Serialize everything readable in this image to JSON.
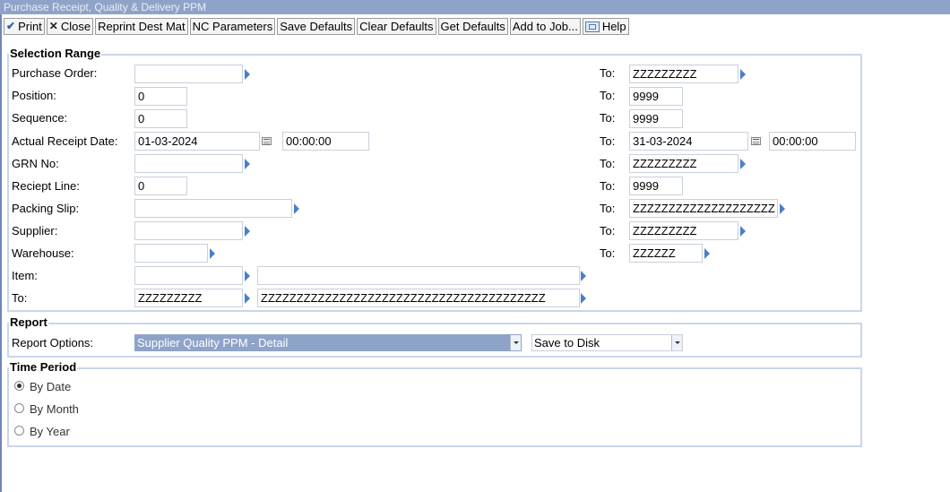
{
  "window": {
    "title": "Purchase Receipt, Quality & Delivery PPM"
  },
  "toolbar": {
    "print": "Print",
    "close": "Close",
    "reprint": "Reprint Dest Mat",
    "nc_parameters": "NC Parameters",
    "save_defaults": "Save Defaults",
    "clear_defaults": "Clear Defaults",
    "get_defaults": "Get Defaults",
    "add_to_job": "Add to Job...",
    "help": "Help"
  },
  "selection": {
    "title": "Selection Range",
    "to_label": "To:",
    "rows": [
      {
        "label": "Purchase Order:",
        "from": "",
        "to": "ZZZZZZZZZ"
      },
      {
        "label": "Position:",
        "from": "0",
        "to": "9999"
      },
      {
        "label": "Sequence:",
        "from": "0",
        "to": "9999"
      },
      {
        "label": "Actual Receipt Date:",
        "from": "01-03-2024",
        "from_time": "00:00:00",
        "to": "31-03-2024",
        "to_time": "00:00:00"
      },
      {
        "label": "GRN No:",
        "from": "",
        "to": "ZZZZZZZZZ"
      },
      {
        "label": "Reciept Line:",
        "from": "0",
        "to": "9999"
      },
      {
        "label": "Packing Slip:",
        "from": "",
        "to": "ZZZZZZZZZZZZZZZZZZZZ"
      },
      {
        "label": "Supplier:",
        "from": "",
        "to": "ZZZZZZZZZ"
      },
      {
        "label": "Warehouse:",
        "from": "",
        "to": "ZZZZZZ"
      }
    ],
    "item": {
      "label": "Item:",
      "code": "",
      "desc": ""
    },
    "item_to": {
      "label": "To:",
      "code": "ZZZZZZZZZ",
      "desc": "ZZZZZZZZZZZZZZZZZZZZZZZZZZZZZZZZZZZZZZZZ"
    }
  },
  "report": {
    "title": "Report",
    "options_label": "Report Options:",
    "options_value": "Supplier Quality PPM - Detail",
    "output_value": "Save to Disk"
  },
  "time_period": {
    "title": "Time Period",
    "options": [
      "By Date",
      "By Month",
      "By Year"
    ],
    "selected": "By Date"
  },
  "icons": {
    "print": "check-icon",
    "close": "x-icon",
    "help": "help-icon",
    "zoom": "zoom-arrow-icon",
    "calendar": "calendar-icon"
  },
  "colors": {
    "titlebar": "#8fa3c8",
    "group_border": "#c9d6ea",
    "zoom_arrow": "#4a7fc8",
    "highlight": "#8fa3c8"
  }
}
